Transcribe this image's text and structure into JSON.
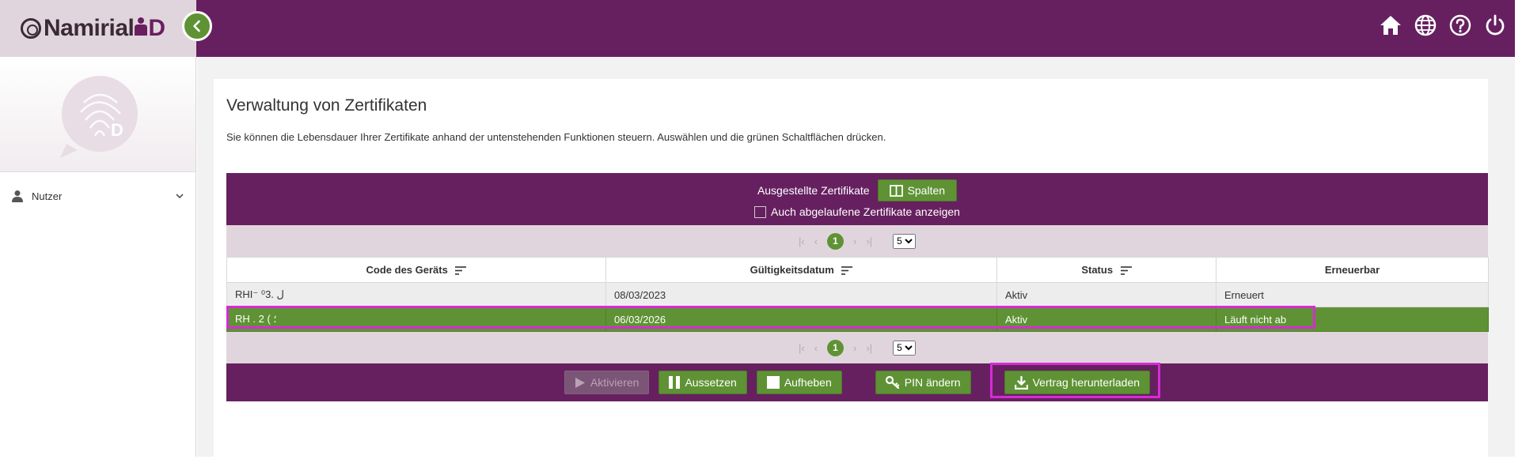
{
  "header": {
    "logo_text": "Namirial",
    "logo_suffix": "D"
  },
  "sidebar": {
    "user_menu_label": "Nutzer"
  },
  "main": {
    "title": "Verwaltung von Zertifikaten",
    "description": "Sie können die Lebensdauer Ihrer Zertifikate anhand der untenstehenden Funktionen steuern. Auswählen und die grünen Schaltflächen drücken."
  },
  "table": {
    "caption": "Ausgestellte Zertifikate",
    "columns_button": "Spalten",
    "show_expired_label": "Auch abgelaufene Zertifikate anzeigen",
    "show_expired_checked": false,
    "paginator": {
      "current_page": "1",
      "page_size": "5",
      "page_size_options": [
        "5"
      ]
    },
    "headers": [
      "Code des Geräts",
      "Gültigkeitsdatum",
      "Status",
      "Erneuerbar"
    ],
    "rows": [
      [
        "RHI⁻ ⁰ل .3",
        "08/03/2023",
        "Aktiv",
        "Erneuert"
      ],
      [
        "RH . 2 ( ؛",
        "06/03/2026",
        "Aktiv",
        "Läuft nicht ab"
      ]
    ],
    "selected_row": 1
  },
  "actions": {
    "activate": "Aktivieren",
    "suspend": "Aussetzen",
    "revoke": "Aufheben",
    "change_pin": "PIN ändern",
    "download_contract": "Vertrag herunterladen"
  },
  "colors": {
    "primary": "#662060",
    "accent": "#5f9234",
    "header_light": "#e1d5dd",
    "highlight": "#d62bd6"
  }
}
